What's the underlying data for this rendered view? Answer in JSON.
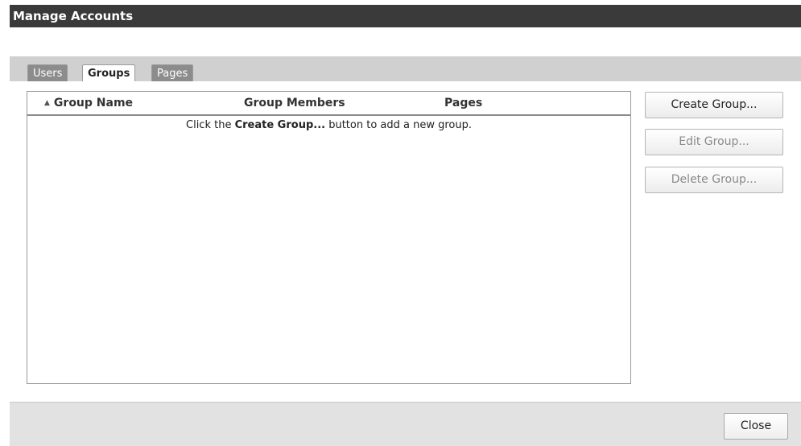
{
  "window": {
    "title": "Manage Accounts"
  },
  "tabs": [
    {
      "label": "Users",
      "active": false
    },
    {
      "label": "Groups",
      "active": true
    },
    {
      "label": "Pages",
      "active": false
    }
  ],
  "grid": {
    "columns": [
      "Group Name",
      "Group Members",
      "Pages"
    ],
    "sort_column": "Group Name",
    "sort_direction": "ascending",
    "empty_message": {
      "prefix": "Click the ",
      "emphasis": "Create Group...",
      "suffix": " button to add a new group."
    }
  },
  "actions": {
    "create": "Create Group...",
    "edit": "Edit Group...",
    "delete": "Delete Group..."
  },
  "footer": {
    "close": "Close"
  },
  "icons": {
    "sort": "sort-ascending-icon",
    "sort_glyph": "▲"
  }
}
